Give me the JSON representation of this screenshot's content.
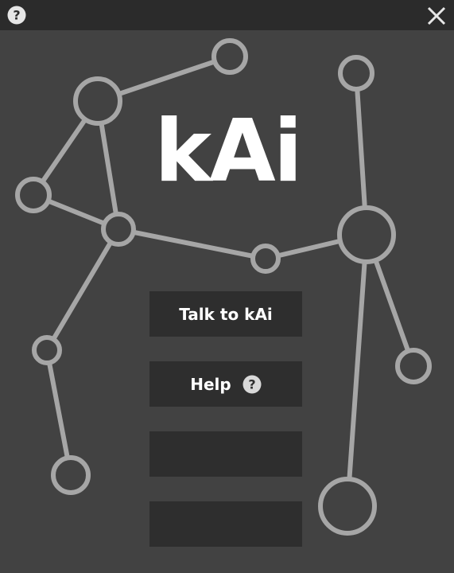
{
  "app": {
    "logo_text": "kAi"
  },
  "titlebar": {
    "help_icon": "question-circle-icon",
    "close_icon": "close-x-icon"
  },
  "menu": {
    "talk_label": "Talk to kAi",
    "help_label": "Help",
    "help_icon": "question-circle-icon",
    "empty_button_1_label": "",
    "empty_button_2_label": ""
  },
  "colors": {
    "background": "#424242",
    "titlebar": "#2b2b2b",
    "button": "#2e2e2e",
    "network_stroke": "#a6a6a6",
    "text": "#ffffff"
  }
}
